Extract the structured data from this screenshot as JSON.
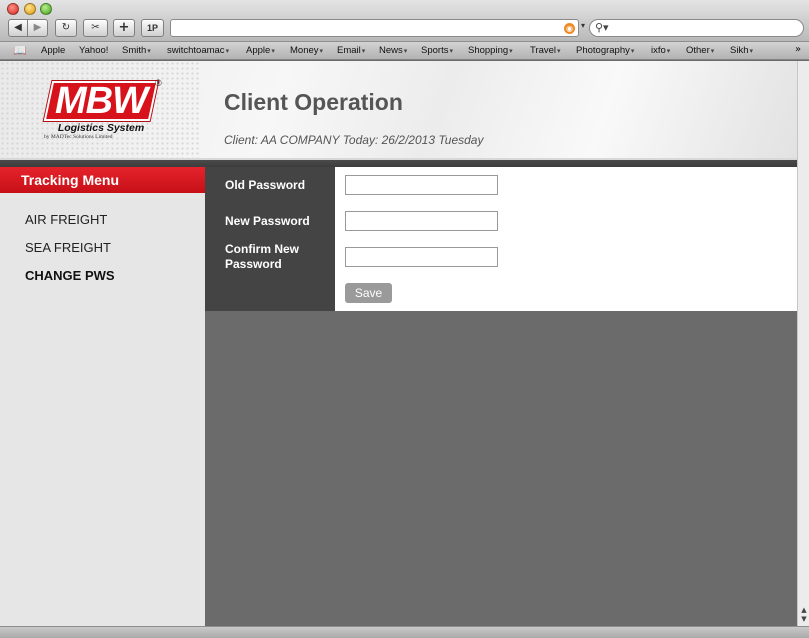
{
  "browser": {
    "toolbar": {
      "back_glyph": "◀",
      "forward_glyph": "▶",
      "reload_glyph": "↻",
      "capture_glyph": "✂",
      "add_glyph": "+",
      "onepassword_label": "1P"
    },
    "url": "",
    "search_placeholder": "",
    "bookmarks": [
      {
        "label": "Apple",
        "menu": false
      },
      {
        "label": "Yahoo!",
        "menu": false
      },
      {
        "label": "Smith",
        "menu": true
      },
      {
        "label": "switchtoamac",
        "menu": true
      },
      {
        "label": "Apple",
        "menu": true
      },
      {
        "label": "Money",
        "menu": true
      },
      {
        "label": "Email",
        "menu": true
      },
      {
        "label": "News",
        "menu": true
      },
      {
        "label": "Sports",
        "menu": true
      },
      {
        "label": "Shopping",
        "menu": true
      },
      {
        "label": "Travel",
        "menu": true
      },
      {
        "label": "Photography",
        "menu": true
      },
      {
        "label": "ixfo",
        "menu": true
      },
      {
        "label": "Other",
        "menu": true
      },
      {
        "label": "Sikh",
        "menu": true
      }
    ],
    "bookmarks_more": "»"
  },
  "logo": {
    "text": "MBW",
    "registered": "®",
    "subtitle": "Logistics System",
    "tagline": "by MADTec Solutions Limited"
  },
  "header": {
    "title": "Client Operation",
    "client_info": "Client: AA COMPANY Today: 26/2/2013 Tuesday"
  },
  "sidebar": {
    "title": "Tracking Menu",
    "items": [
      {
        "label": "AIR FREIGHT",
        "active": false
      },
      {
        "label": "SEA FREIGHT",
        "active": false
      },
      {
        "label": "CHANGE PWS",
        "active": true
      }
    ]
  },
  "form": {
    "old_password_label": "Old Password",
    "old_password_value": "",
    "new_password_label": "New Password",
    "new_password_value": "",
    "confirm_password_label": "Confirm New Password",
    "confirm_password_value": "",
    "save_label": "Save"
  },
  "colors": {
    "accent_red": "#d8121b",
    "label_cell": "#444444",
    "content_bg": "#6b6b6b",
    "sidebar_bg": "#e6e6e6"
  }
}
